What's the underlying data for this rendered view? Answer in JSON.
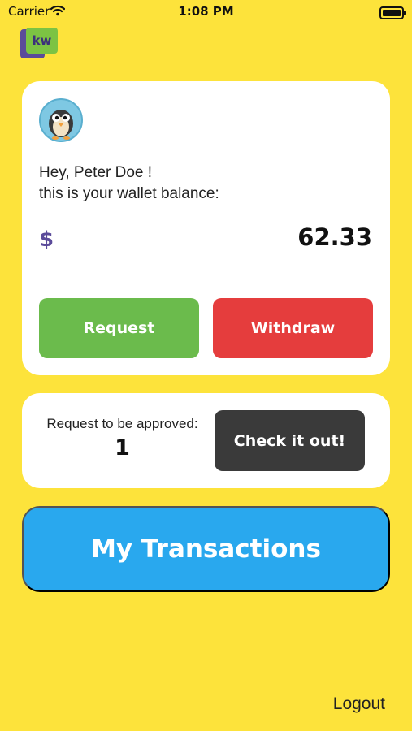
{
  "status_bar": {
    "carrier": "Carrier",
    "time": "1:08 PM"
  },
  "logo": {
    "text": "kw"
  },
  "balance": {
    "greeting_line1": "Hey, Peter Doe !",
    "greeting_line2": "this is your wallet balance:",
    "currency_symbol": "$",
    "amount": "62.33",
    "request_label": "Request",
    "withdraw_label": "Withdraw"
  },
  "approval": {
    "label": "Request to be approved:",
    "count": "1",
    "check_label": "Check it out!"
  },
  "transactions_label": "My Transactions",
  "logout_label": "Logout",
  "colors": {
    "background": "#FDE33B",
    "request": "#6BBB4C",
    "withdraw": "#E53D3D",
    "check": "#3A3A3A",
    "transactions": "#29A8EE",
    "currency": "#5B4B9A"
  },
  "icons": {
    "wifi": "wifi-icon",
    "battery": "battery-icon",
    "avatar": "penguin-avatar"
  }
}
